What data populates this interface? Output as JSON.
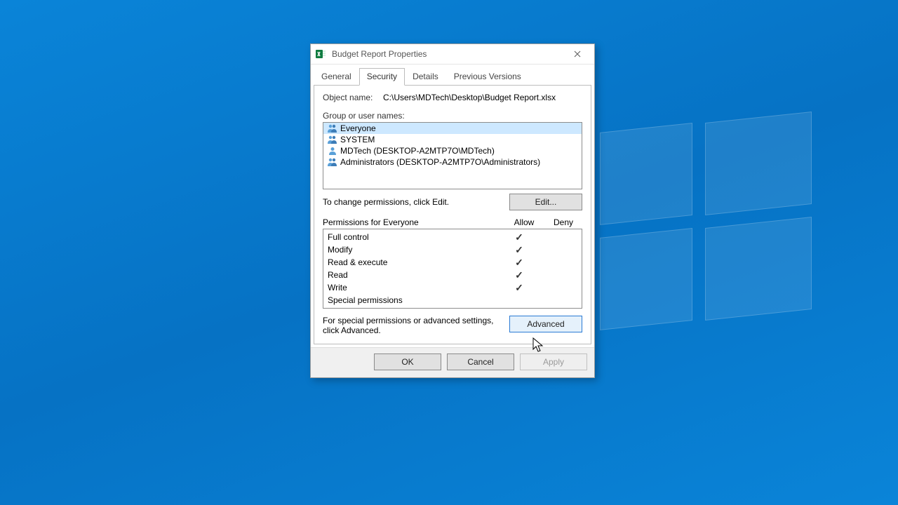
{
  "dialog": {
    "title": "Budget Report Properties",
    "tabs": {
      "general": "General",
      "security": "Security",
      "details": "Details",
      "previous": "Previous Versions"
    },
    "object_name_label": "Object name:",
    "object_path": "C:\\Users\\MDTech\\Desktop\\Budget Report.xlsx",
    "groups_label": "Group or user names:",
    "groups": [
      {
        "name": "Everyone",
        "type": "group",
        "selected": true
      },
      {
        "name": "SYSTEM",
        "type": "group",
        "selected": false
      },
      {
        "name": "MDTech (DESKTOP-A2MTP7O\\MDTech)",
        "type": "user",
        "selected": false
      },
      {
        "name": "Administrators (DESKTOP-A2MTP7O\\Administrators)",
        "type": "group",
        "selected": false
      }
    ],
    "edit_hint": "To change permissions, click Edit.",
    "edit_button": "Edit...",
    "perm_header_label": "Permissions for Everyone",
    "col_allow": "Allow",
    "col_deny": "Deny",
    "permissions": [
      {
        "name": "Full control",
        "allow": true,
        "deny": false
      },
      {
        "name": "Modify",
        "allow": true,
        "deny": false
      },
      {
        "name": "Read & execute",
        "allow": true,
        "deny": false
      },
      {
        "name": "Read",
        "allow": true,
        "deny": false
      },
      {
        "name": "Write",
        "allow": true,
        "deny": false
      },
      {
        "name": "Special permissions",
        "allow": false,
        "deny": false
      }
    ],
    "advanced_hint": "For special permissions or advanced settings, click Advanced.",
    "advanced_button": "Advanced",
    "ok": "OK",
    "cancel": "Cancel",
    "apply": "Apply"
  }
}
